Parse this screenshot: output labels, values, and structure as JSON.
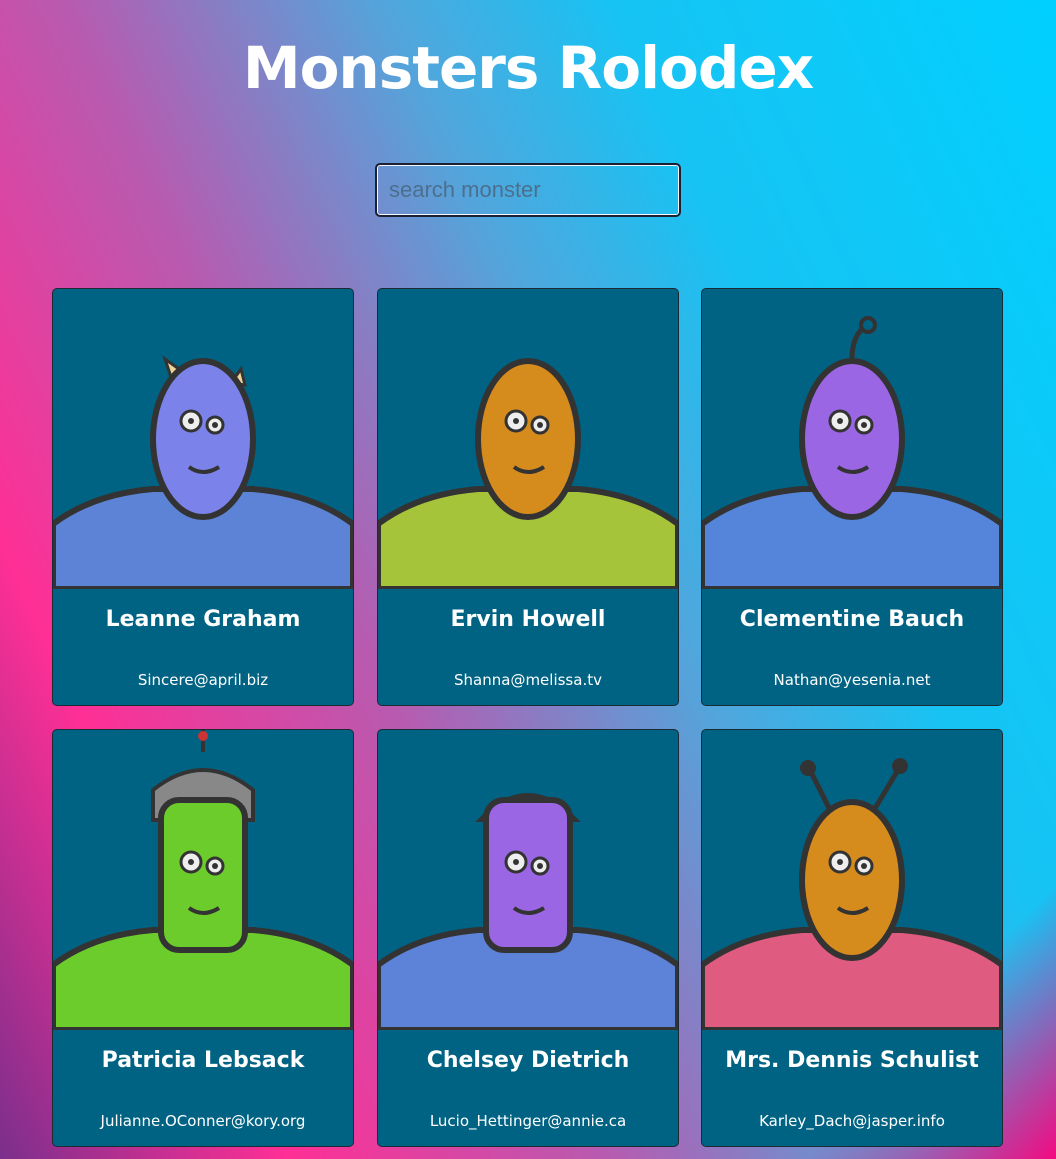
{
  "page": {
    "title": "Monsters Rolodex"
  },
  "search": {
    "placeholder": "search monster",
    "value": ""
  },
  "monsters": [
    {
      "name": "Leanne Graham",
      "email": "Sincere@april.biz",
      "skin": "#7b83ea",
      "body": "#5c83d6",
      "icon": "horned-monster-icon"
    },
    {
      "name": "Ervin Howell",
      "email": "Shanna@melissa.tv",
      "skin": "#d68c1d",
      "body": "#a6c43a",
      "icon": "grinning-monster-icon"
    },
    {
      "name": "Clementine Bauch",
      "email": "Nathan@yesenia.net",
      "skin": "#9b66e3",
      "body": "#5585da",
      "icon": "three-eyed-robot-monster-icon"
    },
    {
      "name": "Patricia Lebsack",
      "email": "Julianne.OConner@kory.org",
      "skin": "#6ccc2c",
      "body": "#6ccc2c",
      "icon": "helmet-monster-icon"
    },
    {
      "name": "Chelsey Dietrich",
      "email": "Lucio_Hettinger@annie.ca",
      "skin": "#9b66e3",
      "body": "#5d83d8",
      "icon": "visor-monster-icon"
    },
    {
      "name": "Mrs. Dennis Schulist",
      "email": "Karley_Dach@jasper.info",
      "skin": "#d68c1d",
      "body": "#e05b80",
      "icon": "antenna-monster-icon"
    }
  ]
}
